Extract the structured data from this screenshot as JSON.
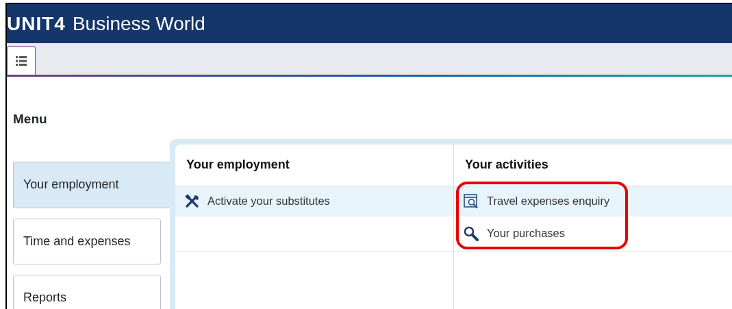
{
  "header": {
    "logo": "UNIT4",
    "title": "Business World"
  },
  "tabs": [
    {
      "kind": "list",
      "selected": true
    }
  ],
  "menu": {
    "title": "Menu",
    "items": [
      {
        "label": "Your employment",
        "selected": true
      },
      {
        "label": "Time and expenses",
        "selected": false
      },
      {
        "label": "Reports",
        "selected": false
      }
    ]
  },
  "panel": {
    "columns": [
      {
        "title": "Your employment",
        "items": [
          {
            "kind": "tools",
            "label": "Activate your substitutes"
          }
        ]
      },
      {
        "title": "Your activities",
        "annotation_outline": true,
        "items": [
          {
            "kind": "document-search",
            "label": "Travel expenses enquiry"
          },
          {
            "kind": "search",
            "label": "Your purchases"
          }
        ]
      }
    ],
    "rows": [
      {
        "selected": true
      },
      {
        "selected": false
      }
    ]
  }
}
